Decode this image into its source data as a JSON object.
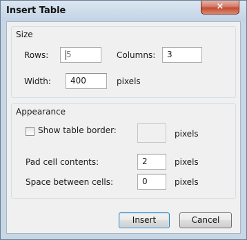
{
  "dialog": {
    "title": "Insert Table",
    "close_symbol": "×"
  },
  "size": {
    "legend": "Size",
    "rows_label": "Rows:",
    "rows_value": "5",
    "columns_label": "Columns:",
    "columns_value": "3",
    "width_label": "Width:",
    "width_value": "400",
    "width_unit": "pixels"
  },
  "appearance": {
    "legend": "Appearance",
    "border_label": "Show table border:",
    "border_checked": false,
    "border_value": "",
    "border_unit": "pixels",
    "padding_label": "Pad cell contents:",
    "padding_value": "2",
    "padding_unit": "pixels",
    "spacing_label": "Space between cells:",
    "spacing_value": "0",
    "spacing_unit": "pixels"
  },
  "buttons": {
    "insert": "Insert",
    "cancel": "Cancel"
  },
  "colors": {
    "titlebar": "#c8d7e6",
    "close_button": "#c24a32",
    "dialog_background": "#f0f0f0"
  }
}
